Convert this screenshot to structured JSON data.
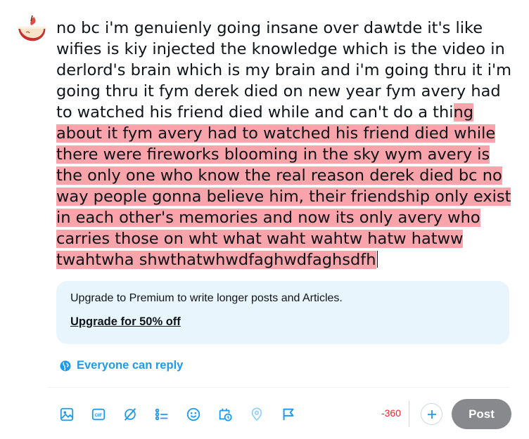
{
  "composer": {
    "text_within_limit": "no bc i'm genuienly going insane over dawtde it's like wifies is kiy injected the knowledge which is the video in derlord's brain which is my brain and i'm going thru it i'm going thru it fym derek died on new year fym avery had to watched his friend died while and can't do a thi",
    "text_over_limit": "ng about it fym avery had to watched his friend died while there were fireworks blooming in the sky wym avery is the only one who know the real reason derek died bc no way people gonna believe him, their friendship only exist in each other's memories and now its only avery who carries those on wht what waht wahtw hatw hatww twahtwha shwthatwhwdfaghwdfaghsdfh",
    "overflow_highlight_color": "#f9a3ab"
  },
  "upsell": {
    "message": "Upgrade to Premium to write longer posts and Articles.",
    "link_label": "Upgrade for 50% off"
  },
  "reply_setting": {
    "label": "Everyone can reply",
    "icon": "globe-icon"
  },
  "toolbar": {
    "tools": [
      {
        "name": "media",
        "icon": "image-icon"
      },
      {
        "name": "gif",
        "icon": "gif-icon"
      },
      {
        "name": "grok",
        "icon": "grok-icon"
      },
      {
        "name": "poll",
        "icon": "poll-icon"
      },
      {
        "name": "emoji",
        "icon": "emoji-icon"
      },
      {
        "name": "schedule",
        "icon": "schedule-icon"
      },
      {
        "name": "location",
        "icon": "location-icon"
      },
      {
        "name": "flag",
        "icon": "flag-icon"
      }
    ]
  },
  "footer": {
    "char_counter": "-360",
    "post_label": "Post"
  },
  "colors": {
    "accent": "#1d9bf0",
    "counter_over": "#f4212e",
    "post_disabled": "#87898c",
    "upsell_bg": "#e8f5fd"
  }
}
